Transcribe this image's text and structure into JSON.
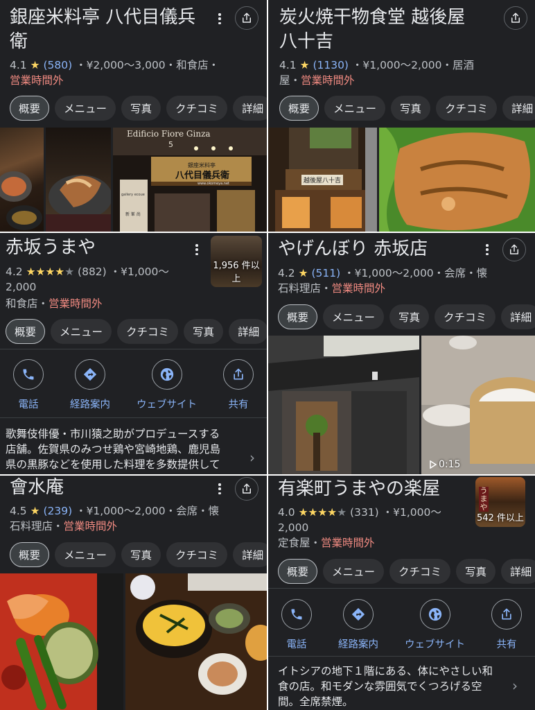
{
  "cards": [
    {
      "name_line1": "銀座米料亭 八代目儀兵",
      "name_line2": "衛",
      "rating": "4.1",
      "stars": "★",
      "reviews": "(580)",
      "info": "・¥2,000〜3,000・和食店・",
      "status": "営業時間外",
      "chips": [
        "概要",
        "メニュー",
        "写真",
        "クチコミ",
        "詳細"
      ],
      "sign_small": "銀座米料亭",
      "sign_main": "八代目儀兵衛",
      "sign_top": "Edificio Fiore Ginza",
      "sign_url": "www.okomeya.net",
      "sign_num": "5",
      "gallery_sign": "gallery ecoue",
      "sub_sign": "新 峯 尚"
    },
    {
      "name_line1": "炭火焼干物食堂 越後屋",
      "name_line2": "八十吉",
      "rating": "4.1",
      "stars": "★",
      "reviews": "(1130)",
      "info": "・¥1,000〜2,000・居酒",
      "info2": "屋・",
      "status": "営業時間外",
      "chips": [
        "概要",
        "メニュー",
        "写真",
        "クチコミ",
        "詳細"
      ],
      "shop_sign": "越後屋八十吉"
    },
    {
      "name": "赤坂うまや",
      "rating": "4.2",
      "stars": "★★★★",
      "star_grey": "★",
      "reviews": "(882)",
      "info": "・¥1,000〜",
      "info2": "2,000",
      "category": "和食店・",
      "status": "営業時間外",
      "thumb_label": "1,956 件以上",
      "chips": [
        "概要",
        "メニュー",
        "クチコミ",
        "写真",
        "詳細"
      ],
      "actions": [
        "電話",
        "経路案内",
        "ウェブサイト",
        "共有"
      ],
      "description": [
        "歌舞伎俳優・市川猿之助がプロデュースする",
        "店舗。佐賀県のみつせ鶏や宮崎地鶏、鹿児島",
        "県の黒豚などを使用した料理を多数提供して"
      ]
    },
    {
      "name": "やげんぼり 赤坂店",
      "rating": "4.2",
      "stars": "★",
      "reviews": "(511)",
      "info": "・¥1,000〜2,000・会席・懐",
      "info2": "石料理店・",
      "status": "営業時間外",
      "chips": [
        "概要",
        "メニュー",
        "写真",
        "クチコミ",
        "詳細"
      ],
      "video_time": "0:15"
    },
    {
      "name": "會水庵",
      "rating": "4.5",
      "stars": "★",
      "reviews": "(239)",
      "info": "・¥1,000〜2,000・会席・懐",
      "info2": "石料理店・",
      "status": "営業時間外",
      "chips": [
        "概要",
        "メニュー",
        "写真",
        "クチコミ",
        "詳細"
      ]
    },
    {
      "name": "有楽町うまやの楽屋",
      "rating": "4.0",
      "stars": "★★★★",
      "star_grey": "★",
      "reviews": "(331)",
      "info": "・¥1,000〜",
      "info2": "2,000",
      "category": "定食屋・",
      "status": "営業時間外",
      "thumb_label": "542 件以上",
      "thumb_sign": "うまや",
      "chips": [
        "概要",
        "メニュー",
        "クチコミ",
        "写真",
        "詳細"
      ],
      "actions": [
        "電話",
        "経路案内",
        "ウェブサイト",
        "共有"
      ],
      "description": [
        "イトシアの地下１階にある、体にやさしい和",
        "食の店。和モダンな雰囲気でくつろげる空",
        "間。全席禁煙。"
      ]
    }
  ],
  "colors": {
    "card_bg": "#202124",
    "text": "#e8eaed",
    "secondary": "#bdc1c6",
    "link": "#8ab4f8",
    "closed": "#f28b82",
    "star": "#fdd663",
    "chip_bg": "#303134"
  },
  "icons": [
    "more-vert-icon",
    "share-icon",
    "phone-icon",
    "directions-icon",
    "website-globe-icon",
    "chevron-right-icon",
    "play-icon"
  ]
}
